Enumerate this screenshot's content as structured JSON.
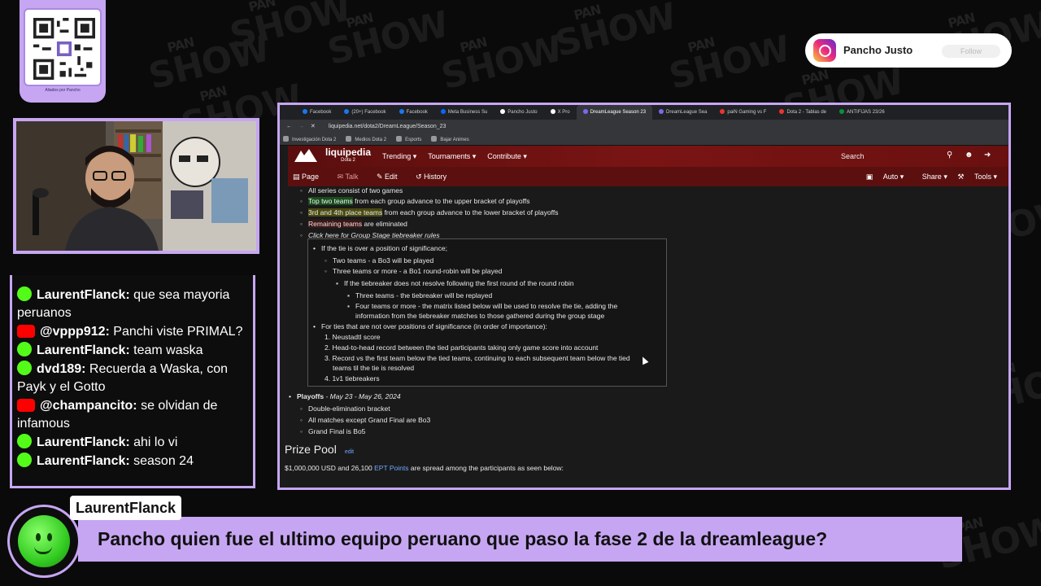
{
  "watermark": {
    "brand_top": "PAN",
    "brand_bottom": "SHOW"
  },
  "qr": {
    "caption": "Aliados por Pancho"
  },
  "instagram": {
    "name": "Pancho Justo",
    "follow_label": "Follow"
  },
  "chat": {
    "messages": [
      {
        "platform": "kick",
        "user": "LaurentFlanck:",
        "text": " que sea mayoria peruanos"
      },
      {
        "platform": "youtube",
        "user": "@vppp912:",
        "text": " Panchi viste PRIMAL?"
      },
      {
        "platform": "kick",
        "user": "LaurentFlanck:",
        "text": " team waska"
      },
      {
        "platform": "kick",
        "user": "dvd189:",
        "text": " Recuerda a Waska, con Payk y el Gotto"
      },
      {
        "platform": "youtube",
        "user": "@champancito:",
        "text": " se olvidan de infamous"
      },
      {
        "platform": "kick",
        "user": "LaurentFlanck:",
        "text": " ahi lo vi"
      },
      {
        "platform": "kick",
        "user": "LaurentFlanck:",
        "text": " season 24"
      }
    ]
  },
  "browser": {
    "tabs": [
      {
        "label": "Facebook",
        "color": "#1877f2"
      },
      {
        "label": "(20+) Facebook",
        "color": "#1877f2"
      },
      {
        "label": "Facebook",
        "color": "#1877f2"
      },
      {
        "label": "Meta Business Su",
        "color": "#0866ff"
      },
      {
        "label": "Pancho Justo",
        "color": "#ffffff"
      },
      {
        "label": "X Pro",
        "color": "#ffffff"
      },
      {
        "label": "DreamLeague Season 23",
        "color": "#7b68ee"
      },
      {
        "label": "DreamLeague Sea",
        "color": "#7b68ee"
      },
      {
        "label": "paiN Gaming vs F",
        "color": "#e33"
      },
      {
        "label": "Dota 2 - Tablas de",
        "color": "#e33"
      },
      {
        "label": "ANTIFIJAS 23/26",
        "color": "#0a8f3c"
      }
    ],
    "url": "liquipedia.net/dota2/DreamLeague/Season_23",
    "bookmarks": [
      "Investigación Dota 2",
      "Medios Dota 2",
      "Esports",
      "Bajar Animes"
    ]
  },
  "liquipedia": {
    "brand": "liquipedia",
    "brand_sub": "Dota 2",
    "nav": [
      "Trending",
      "Tournaments",
      "Contribute"
    ],
    "search_label": "Search",
    "subnav_left": [
      "Page",
      "Talk",
      "Edit",
      "History"
    ],
    "subnav_right": [
      "Auto",
      "Share",
      "Tools"
    ]
  },
  "content": {
    "line1": "All series consist of two games",
    "line2_hl": "Top two teams",
    "line2_rest": " from each group advance to the upper bracket of playoffs",
    "line3_hl": "3rd and 4th place teams",
    "line3_rest": " from each group advance to the lower bracket of playoffs",
    "line4_hl": "Remaining teams",
    "line4_rest": " are eliminated",
    "line5": "Click here for Group Stage tiebreaker rules",
    "tie1": "If the tie is over a position of significance;",
    "tie2": "Two teams - a Bo3 will be played",
    "tie3": "Three teams or more - a Bo1 round-robin will be played",
    "tie4": "If the tiebreaker does not resolve following the first round of the round robin",
    "tie5": "Three teams - the tiebreaker will be replayed",
    "tie6a": "Four teams or more - the matrix listed below will be used to resolve the tie, adding the",
    "tie6b": "information from the tiebreaker matches to those gathered during the group stage",
    "tie7": "For ties that are not over positions of significance (in order of importance):",
    "tie8": "1. Neustadtl score",
    "tie9": "2. Head-to-head record between the tied participants taking only game score into account",
    "tie10a": "3. Record vs the first team below the tied teams, continuing to each subsequent team below the tied",
    "tie10b": "teams til the tie is resolved",
    "tie11": "4. 1v1 tiebreakers",
    "playoffs_title": "Playoffs",
    "playoffs_dates": " - May 23 - May 26, 2024",
    "po1": "Double-elimination bracket",
    "po2": "All matches except Grand Final are Bo3",
    "po3": "Grand Final is Bo5",
    "prize_title": "Prize Pool",
    "prize_edit": "edit",
    "prize_text_a": "$1,000,000 USD and 26,100 ",
    "prize_link": "EPT Points",
    "prize_text_b": " are spread among the participants as seen below:"
  },
  "overlay": {
    "username": "LaurentFlanck",
    "question": "Pancho quien fue el ultimo equipo peruano que paso la fase 2 de la dreamleague?"
  }
}
